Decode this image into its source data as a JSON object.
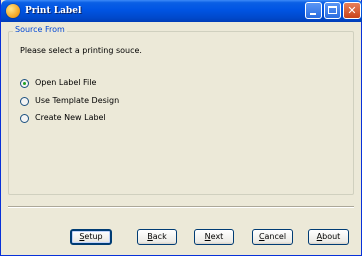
{
  "window": {
    "title": "Print Label"
  },
  "group": {
    "legend": "Source From",
    "prompt": "Please select a printing souce."
  },
  "options": [
    {
      "label": "Open Label File",
      "checked": true
    },
    {
      "label": "Use Template Design",
      "checked": false
    },
    {
      "label": "Create New Label",
      "checked": false
    }
  ],
  "buttons": {
    "setup": {
      "first": "S",
      "rest": "etup"
    },
    "back": {
      "first": "B",
      "rest": "ack"
    },
    "next": {
      "first": "N",
      "rest": "ext"
    },
    "cancel": {
      "first": "C",
      "rest": "ancel"
    },
    "about": {
      "first": "A",
      "rest": "bout"
    }
  },
  "colors": {
    "title_bar": "#0054E3",
    "window_face": "#ECE9D8",
    "group_legend": "#0046D5",
    "radio_dot": "#21A121",
    "close_button": "#C8431A"
  },
  "icons": {
    "app": "print-label-app-icon",
    "minimize": "minimize-icon",
    "maximize": "maximize-icon",
    "close": "close-icon"
  }
}
